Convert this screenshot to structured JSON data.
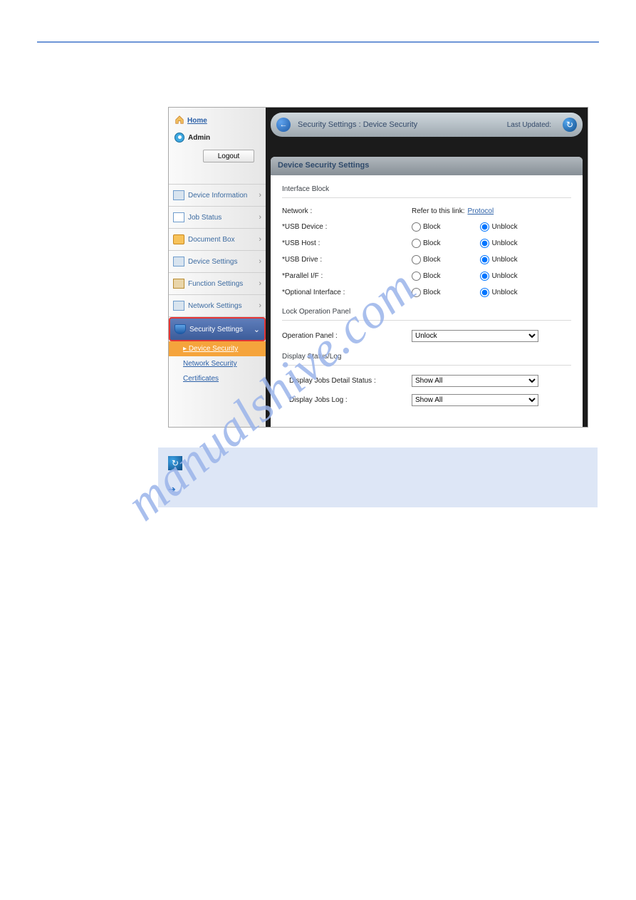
{
  "sidebar": {
    "home_label": "Home",
    "user_label": "Admin",
    "logout_label": "Logout",
    "items": [
      {
        "label": "Device Information"
      },
      {
        "label": "Job Status"
      },
      {
        "label": "Document Box"
      },
      {
        "label": "Device Settings"
      },
      {
        "label": "Function Settings"
      },
      {
        "label": "Network Settings"
      },
      {
        "label": "Security Settings"
      }
    ],
    "subitems": [
      {
        "label": "Device Security",
        "active": true
      },
      {
        "label": "Network Security",
        "active": false
      },
      {
        "label": "Certificates",
        "active": false
      }
    ]
  },
  "header": {
    "breadcrumb": "Security Settings : Device Security",
    "last_updated_label": "Last Updated:"
  },
  "pane": {
    "title": "Device Security Settings",
    "sections": {
      "interface_block": {
        "title": "Interface Block",
        "network_label": "Network :",
        "network_hint": "Refer to this link:",
        "network_link": "Protocol",
        "rows": [
          {
            "label": "*USB Device :",
            "selected": "Unblock"
          },
          {
            "label": "*USB Host :",
            "selected": "Unblock"
          },
          {
            "label": "*USB Drive :",
            "selected": "Unblock"
          },
          {
            "label": "*Parallel I/F :",
            "selected": "Unblock"
          },
          {
            "label": "*Optional Interface :",
            "selected": "Unblock"
          }
        ],
        "option_block": "Block",
        "option_unblock": "Unblock"
      },
      "lock_panel": {
        "title": "Lock Operation Panel",
        "label": "Operation Panel :",
        "value": "Unlock"
      },
      "display_status": {
        "title": "Display Status/Log",
        "rows": [
          {
            "label": "Display Jobs Detail Status :",
            "value": "Show All"
          },
          {
            "label": "Display Jobs Log :",
            "value": "Show All"
          }
        ]
      }
    }
  },
  "watermark": "manualshive.com"
}
